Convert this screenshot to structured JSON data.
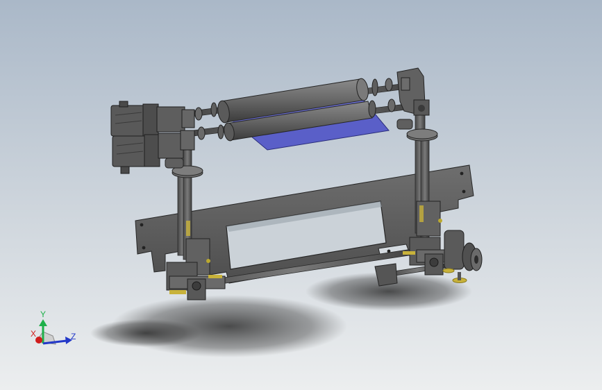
{
  "viewport": {
    "background_top": "#aab8c8",
    "background_bottom": "#eceeef",
    "part_color": "#5c5c5c",
    "film_color": "#5a5fc8"
  },
  "triad": {
    "x_label": "X",
    "y_label": "Y",
    "z_label": "Z",
    "x_color": "#d01c1c",
    "y_color": "#1eb04a",
    "z_color": "#2238c8"
  }
}
